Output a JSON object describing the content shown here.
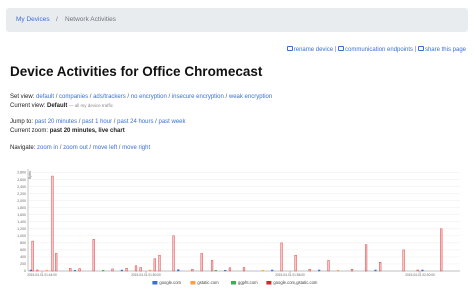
{
  "breadcrumb": {
    "home": "My Devices",
    "separator": "/",
    "current": "Network Activities"
  },
  "actions": {
    "rename": "rename device",
    "endpoints": "communication endpoints",
    "share": "share this page",
    "separator": "|"
  },
  "page_title": "Device Activities for Office Chromecast",
  "set_view": {
    "label": "Set view:",
    "options": [
      "default",
      "companies",
      "ads/trackers",
      "no encryption",
      "insecure encryption",
      "weak encryption"
    ]
  },
  "current_view": {
    "label": "Current view:",
    "value": "Default",
    "hint": "— all my device traffic"
  },
  "jump_to": {
    "label": "Jump to:",
    "options": [
      "past 20 minutes",
      "past 1 hour",
      "past 24 hours",
      "past week"
    ]
  },
  "current_zoom": {
    "label": "Current zoom:",
    "value": "past 20 minutes, live chart"
  },
  "navigate": {
    "label": "Navigate:",
    "options": [
      "zoom in",
      "zoom out",
      "move left",
      "move right"
    ]
  },
  "chart_data": {
    "type": "bar",
    "ylabel": "Bytes",
    "y_ticks": [
      "2,800",
      "2,600",
      "2,400",
      "2,200",
      "2,000",
      "1,800",
      "1,600",
      "1,400",
      "1,200",
      "1,000",
      "800",
      "600",
      "400",
      "200",
      "0"
    ],
    "ylim": [
      0,
      2900
    ],
    "x_tick_labels": [
      "2019-04-01 01:44:00",
      "2019-04-01 01:50:00",
      "2019-04-01 01:56:00",
      "2019-04-01 02:00:00"
    ],
    "series": [
      {
        "name": "google.com",
        "color": "#3b6fd4",
        "values": [
          [
            3,
            30
          ],
          [
            50,
            20
          ],
          [
            100,
            30
          ],
          [
            160,
            40
          ],
          [
            210,
            20
          ],
          [
            260,
            30
          ],
          [
            310,
            30
          ],
          [
            370,
            30
          ],
          [
            420,
            30
          ]
        ]
      },
      {
        "name": "gstatic.com",
        "color": "#ff9f40",
        "values": [
          [
            20,
            25
          ],
          [
            130,
            30
          ],
          [
            250,
            20
          ],
          [
            330,
            20
          ]
        ]
      },
      {
        "name": "ggpht.com",
        "color": "#3fae4f",
        "values": [
          [
            80,
            20
          ],
          [
            200,
            20
          ],
          [
            360,
            20
          ]
        ]
      },
      {
        "name": "google.com,gstatic.com",
        "color": "#d62728",
        "values": [
          [
            5,
            850
          ],
          [
            10,
            30
          ],
          [
            26,
            2700
          ],
          [
            30,
            500
          ],
          [
            45,
            80
          ],
          [
            55,
            70
          ],
          [
            70,
            900
          ],
          [
            90,
            60
          ],
          [
            105,
            80
          ],
          [
            115,
            150
          ],
          [
            120,
            100
          ],
          [
            135,
            350
          ],
          [
            140,
            450
          ],
          [
            155,
            1000
          ],
          [
            175,
            50
          ],
          [
            185,
            500
          ],
          [
            196,
            300
          ],
          [
            215,
            90
          ],
          [
            230,
            100
          ],
          [
            270,
            800
          ],
          [
            285,
            450
          ],
          [
            300,
            50
          ],
          [
            320,
            300
          ],
          [
            345,
            50
          ],
          [
            360,
            750
          ],
          [
            375,
            250
          ],
          [
            400,
            600
          ],
          [
            415,
            30
          ],
          [
            440,
            1200
          ]
        ]
      }
    ],
    "grid": true,
    "legend_position": "bottom"
  }
}
